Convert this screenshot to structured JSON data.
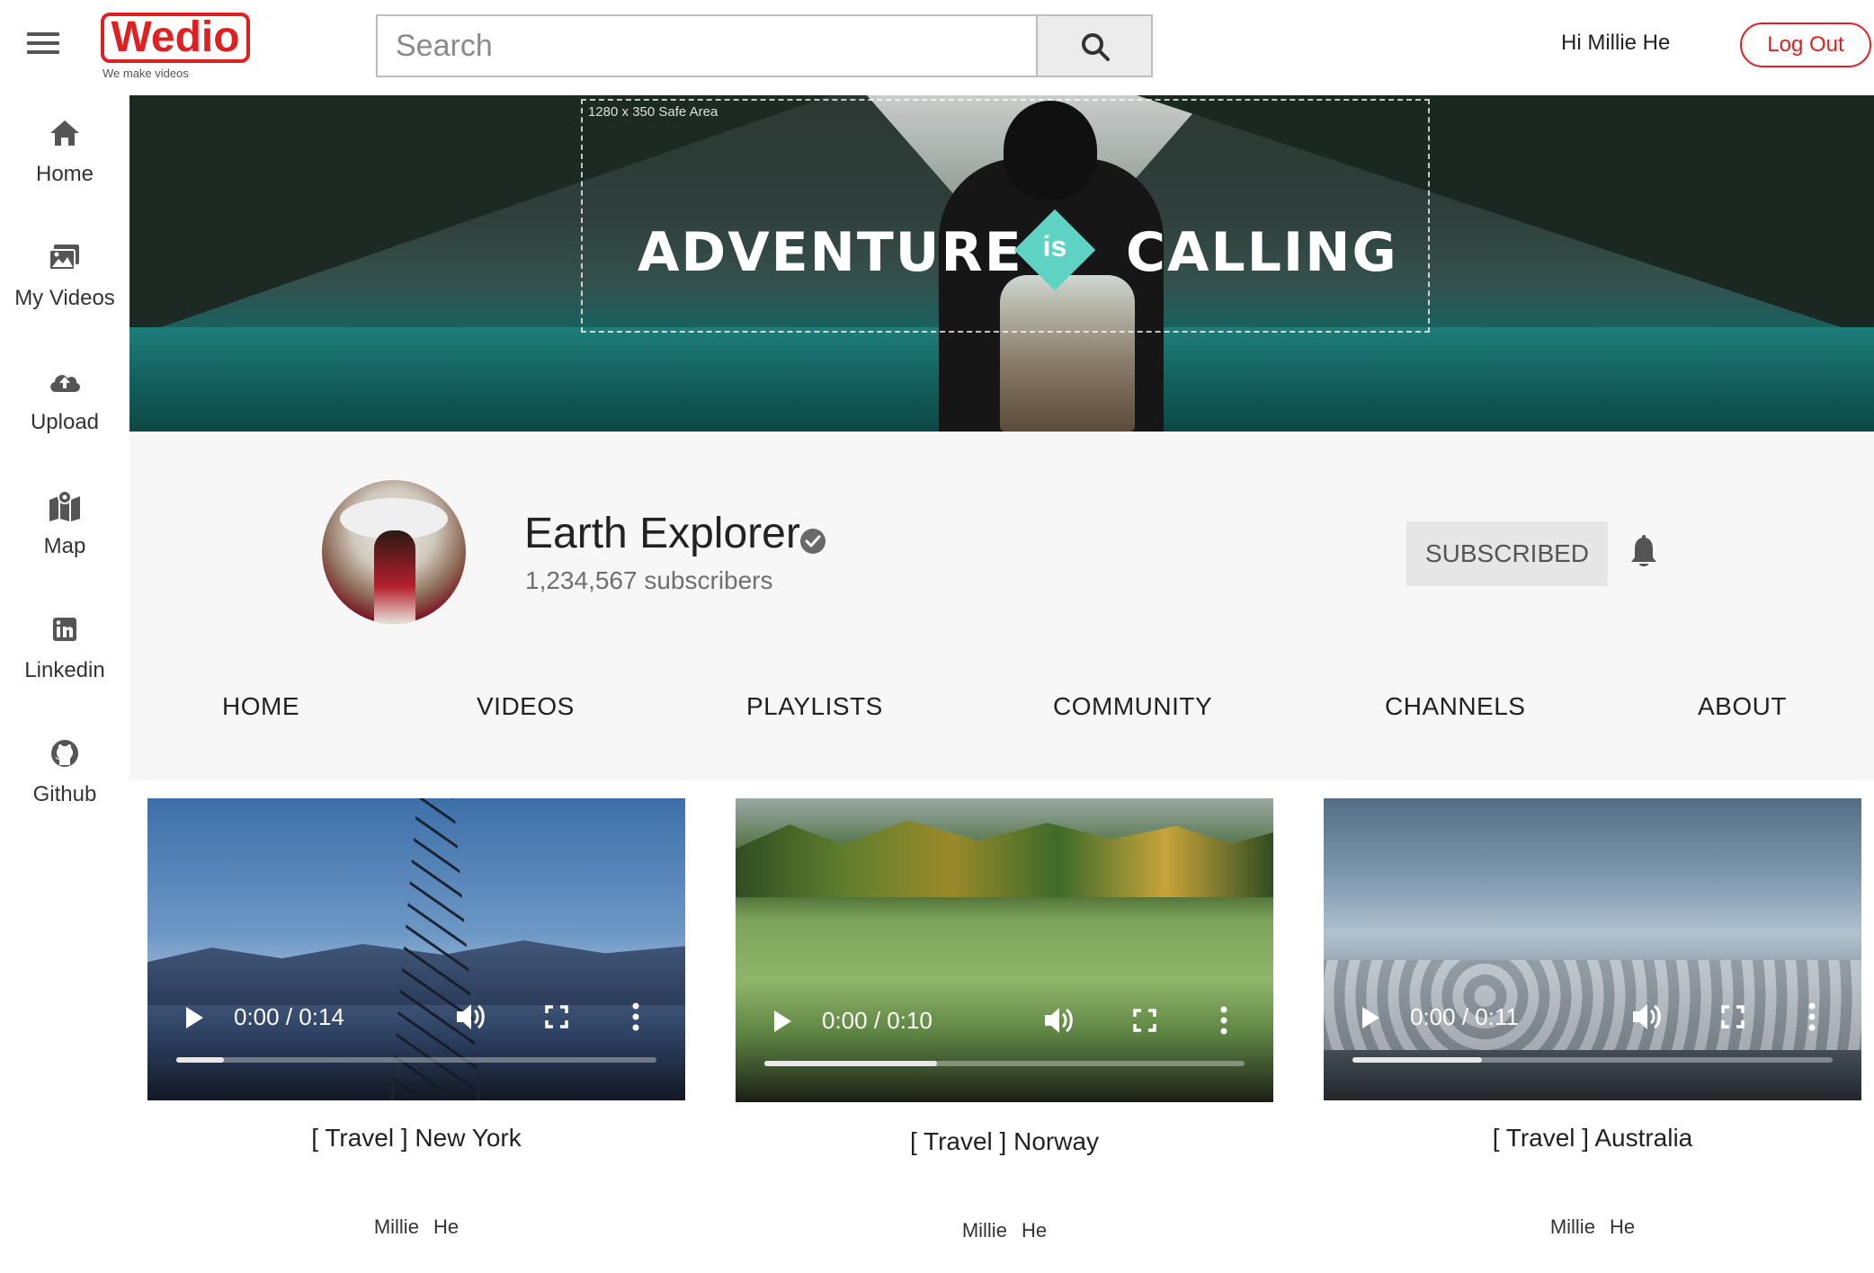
{
  "header": {
    "logo_text": "Wedio",
    "logo_tagline": "We make videos",
    "search_placeholder": "Search",
    "greeting": "Hi Millie He",
    "logout_label": "Log Out",
    "brand_color": "#e02020"
  },
  "sidebar": {
    "items": [
      {
        "label": "Home",
        "icon": "home-icon"
      },
      {
        "label": "My Videos",
        "icon": "photos-icon"
      },
      {
        "label": "Upload",
        "icon": "cloud-upload-icon"
      },
      {
        "label": "Map",
        "icon": "map-icon"
      },
      {
        "label": "Linkedin",
        "icon": "linkedin-icon"
      },
      {
        "label": "Github",
        "icon": "github-icon"
      }
    ]
  },
  "banner": {
    "safe_area_label": "1280 x 350 Safe Area",
    "headline_left": "ADVENTURE",
    "headline_mid": "is",
    "headline_right": "CALLING",
    "accent_color": "#5fd3c3"
  },
  "channel": {
    "name": "Earth Explorer",
    "verified": true,
    "subscribers": "1,234,567 subscribers",
    "subscribe_label": "SUBSCRIBED",
    "tabs": [
      "HOME",
      "VIDEOS",
      "PLAYLISTS",
      "COMMUNITY",
      "CHANNELS",
      "ABOUT"
    ]
  },
  "videos": [
    {
      "title": "[ Travel ] New York",
      "time": "0:00 / 0:14",
      "progress": 0.1,
      "author": "Millie He"
    },
    {
      "title": "[ Travel ] Norway",
      "time": "0:00 / 0:10",
      "progress": 0.36,
      "author": "Millie He"
    },
    {
      "title": "[ Travel ] Australia",
      "time": "0:00 / 0:11",
      "progress": 0.27,
      "author": "Millie He"
    }
  ]
}
